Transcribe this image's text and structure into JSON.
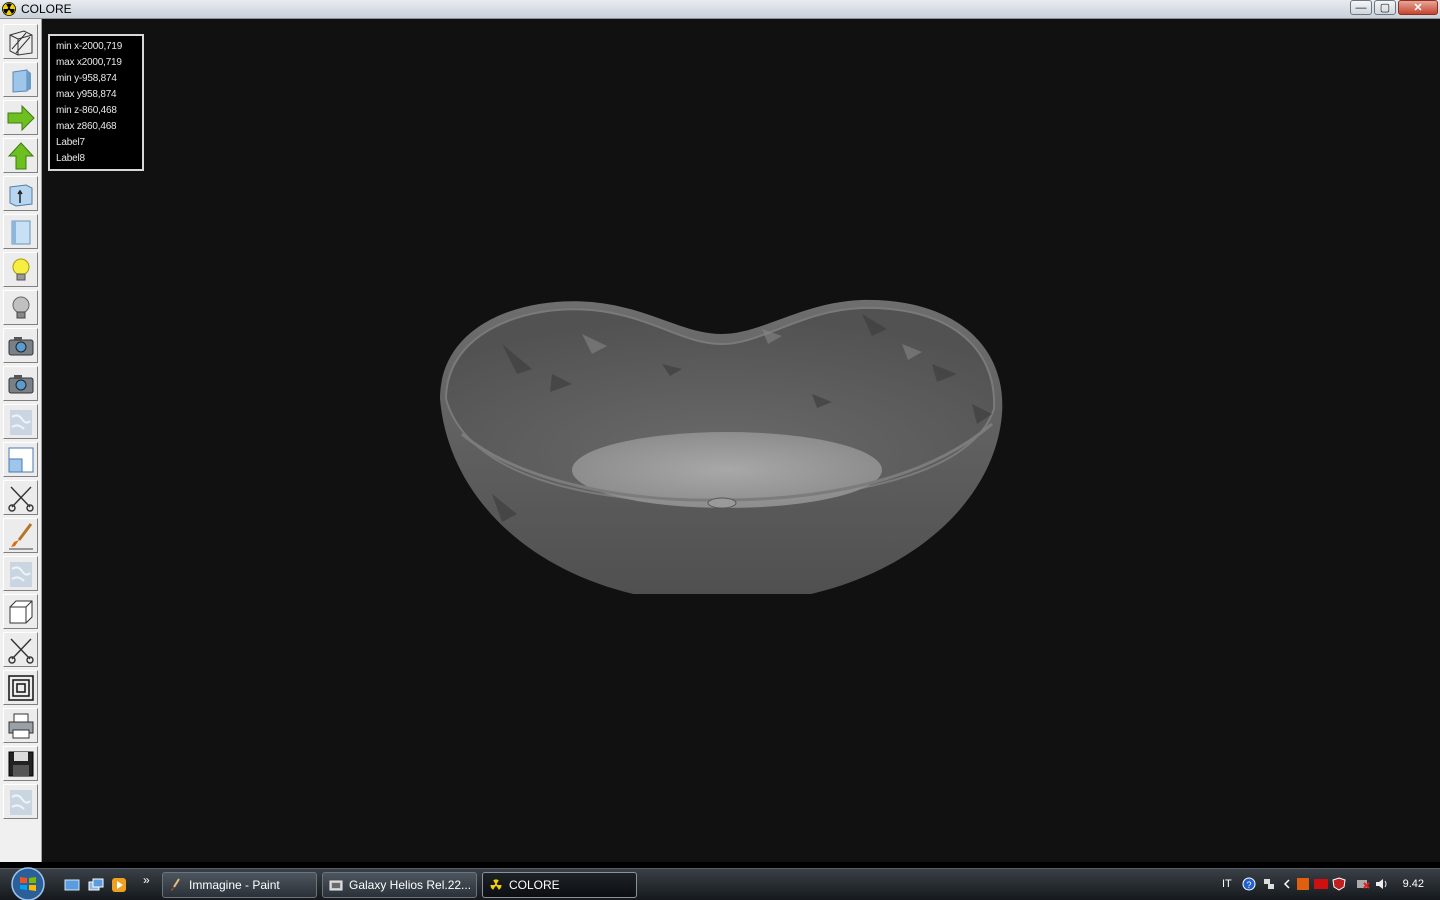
{
  "window": {
    "title": "COLORE",
    "minimize_glyph": "—",
    "maximize_glyph": "▢",
    "close_glyph": "✕"
  },
  "toolbar": {
    "tools": [
      {
        "icon": "wireframe-icon"
      },
      {
        "icon": "solid-cube-icon"
      },
      {
        "icon": "arrow-right-icon"
      },
      {
        "icon": "arrow-up-icon"
      },
      {
        "icon": "extrude-icon"
      },
      {
        "icon": "panel-icon"
      },
      {
        "icon": "light-on-icon"
      },
      {
        "icon": "light-off-icon"
      },
      {
        "icon": "camera-icon"
      },
      {
        "icon": "camera-alt-icon"
      },
      {
        "icon": "texture-icon"
      },
      {
        "icon": "window-split-icon"
      },
      {
        "icon": "scissors-icon"
      },
      {
        "icon": "paint-brush-icon"
      },
      {
        "icon": "texture-alt-icon"
      },
      {
        "icon": "box-icon"
      },
      {
        "icon": "cut-icon"
      },
      {
        "icon": "frame-icon"
      },
      {
        "icon": "printer-icon"
      },
      {
        "icon": "save-disk-icon"
      },
      {
        "icon": "texture-bottom-icon"
      }
    ]
  },
  "info": {
    "lines": [
      "min x-2000,719",
      "max x2000,719",
      "min y-958,874",
      "max y958,874",
      "min z-860,468",
      "max z860,468",
      "Label7",
      "Label8"
    ]
  },
  "taskbar": {
    "more_glyph": "»",
    "tasks": [
      {
        "label": "Immagine - Paint",
        "icon": "paint-icon"
      },
      {
        "label": "Galaxy Helios  Rel.22...",
        "icon": "folder-icon"
      },
      {
        "label": "COLORE",
        "icon": "radiation-icon"
      }
    ],
    "language": "IT",
    "clock": "9.42"
  },
  "colors": {
    "viewport_bg": "#111111",
    "accent_green": "#6ec020"
  }
}
